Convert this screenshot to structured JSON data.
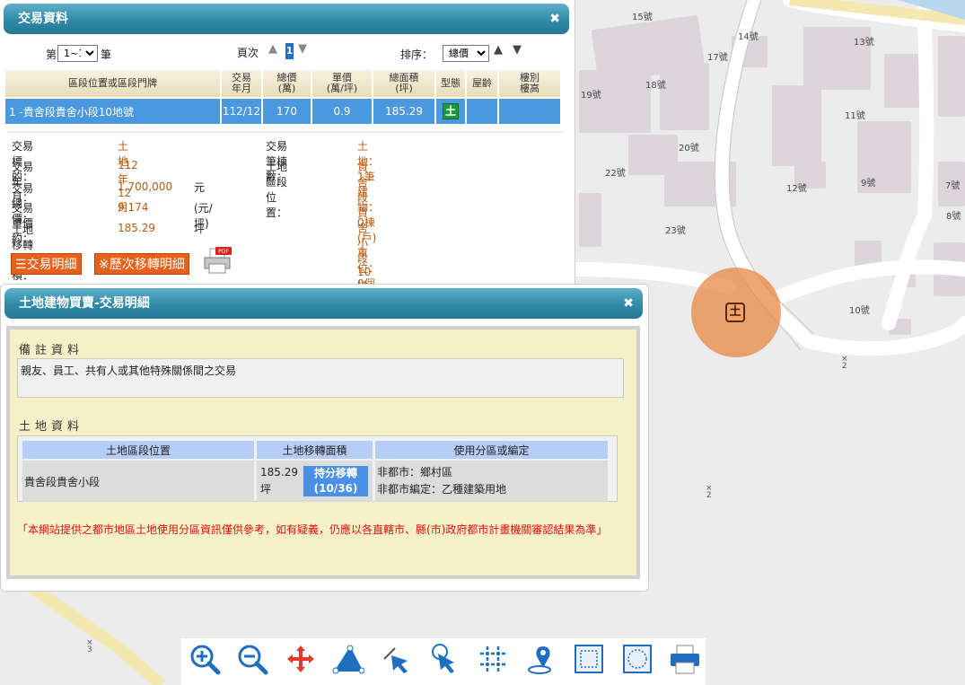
{
  "map": {
    "addresses": [
      "15號",
      "14號",
      "13號",
      "17號",
      "18號",
      "19號",
      "11號",
      "20號",
      "22號",
      "12號",
      "9號",
      "7號",
      "8號",
      "23號",
      "10號"
    ],
    "marker_label": "土",
    "road_marks": [
      "2",
      "2",
      "2",
      "3"
    ]
  },
  "panel1": {
    "title": "交易資料",
    "close": "✖",
    "pager": {
      "prefix": "第",
      "selected": "1~1",
      "suffix": "筆",
      "page_label": "頁次",
      "page_number": "1",
      "sort_label": "排序：",
      "sort_selected": "總價"
    },
    "table": {
      "headers": [
        "區段位置或區段門牌",
        "交易\n年月",
        "總價\n(萬)",
        "單價\n(萬/坪)",
        "總面積\n(坪)",
        "型態",
        "屋齡",
        "樓別\n樓高"
      ],
      "row": {
        "location": "1 -貴舍段貴舍小段10地號",
        "date": "112/12",
        "total": "170",
        "unit": "0.9",
        "area": "185.29",
        "type": "土",
        "age": "",
        "floor": ""
      }
    },
    "details": {
      "target_label": "交易標的：",
      "target_value": "土地",
      "ym_label": "交易年月：",
      "ym_value": "112年12月",
      "total_label": "交易總價：",
      "total_value": "1,700,000",
      "total_unit": "元",
      "unit_label": "交易單價 約：",
      "unit_value": "9,174",
      "unit_unit": "(元/坪)",
      "area_label": "土地移轉總面積：",
      "area_value": "185.29",
      "area_unit": "坪",
      "count_label": "交易筆棟數：",
      "count_value": "土地：1筆 建物：0棟(戶) 車位：0個",
      "sector_label": "土地區段位置：",
      "sector_value": "貴舍段貴舍小段10地號"
    },
    "buttons": {
      "detail": "交易明細",
      "history": "※歷次移轉明細",
      "pdf": "PDF"
    }
  },
  "panel2": {
    "title": "土地建物買賣-交易明細",
    "close": "✖",
    "remark_title": "備註資料",
    "remark_text": "親友、員工、共有人或其他特殊關係間之交易",
    "land_title": "土地資料",
    "land_headers": [
      "土地區段位置",
      "土地移轉面積",
      "使用分區或編定"
    ],
    "land_row": {
      "location": "貴舍段貴舍小段",
      "area": "185.29",
      "area_unit": "坪",
      "share_line1": "持分移轉",
      "share_line2": "(10/36)",
      "zone1": "非都市：鄉村區",
      "zone2": "非都市編定：乙種建築用地"
    },
    "warning": "「本網站提供之都市地區土地使用分區資訊僅供參考，如有疑義，仍應以各直轄市、縣(市)政府都市計畫機關審認結果為準」"
  },
  "toolbar": {
    "tools": [
      "zoom-in",
      "zoom-out",
      "pan",
      "measure-area",
      "select-arrow",
      "click-info",
      "grid",
      "location",
      "select-rect",
      "select-circle",
      "print"
    ]
  }
}
